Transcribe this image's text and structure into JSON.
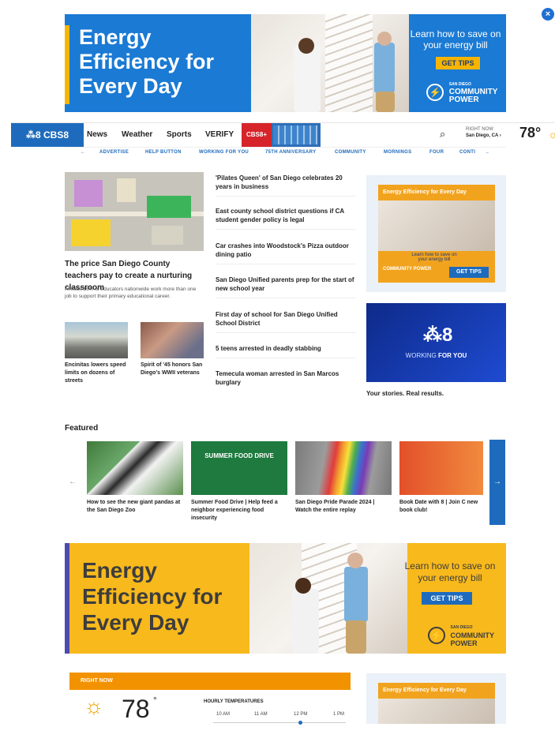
{
  "close": "×",
  "ad_top": {
    "headline": "Energy Efficiency for Every Day",
    "cta_text": "Learn how to save on your energy bill",
    "button": "GET TIPS",
    "logo_top": "SAN DIEGO",
    "logo_mid": "COMMUNITY",
    "logo_bot": "POWER"
  },
  "nav": {
    "brand": "⁂8 CBS8",
    "links": [
      "News",
      "Weather",
      "Sports",
      "VERIFY"
    ],
    "cbs_plus": "CBS8+",
    "search_icon": "⌕",
    "right_now_label": "RIGHT NOW",
    "location": "San Diego, CA ›",
    "temp": "78°",
    "weather_icon": "☼"
  },
  "subnav": [
    "←",
    "ADVERTISE",
    "HELP BUTTON",
    "WORKING FOR YOU",
    "75TH ANNIVERSARY",
    "COMMUNITY",
    "MORNINGS",
    "FOUR",
    "CONTI",
    "→"
  ],
  "lead": {
    "title": "The price San Diego County teachers pay to create a nurturing classroom",
    "subtitle": "At least 16% of educators nationwide work more than one job to support their primary educational career."
  },
  "small_cards": [
    {
      "title": "Encinitas lowers speed limits on dozens of streets"
    },
    {
      "title": "Spirit of '45 honors San Diego's WWII veterans"
    }
  ],
  "headlines": [
    "'Pilates Queen' of San Diego celebrates 20 years in business",
    "East county school district questions if CA student gender policy is legal",
    "Car crashes into Woodstock's Pizza outdoor dining patio",
    "San Diego Unified parents prep for the start of new school year",
    "First day of school for San Diego Unified School District",
    "5 teens arrested in deadly stabbing",
    "Temecula woman arrested in San Marcos burglary"
  ],
  "side_ad": {
    "title": "Energy Efficiency for Every Day",
    "caption": "Learn how to save on your energy bill",
    "button": "GET TIPS",
    "logo": "COMMUNITY POWER"
  },
  "wfy": {
    "logo": "⁂8",
    "text_pre": "WORKING",
    "text_bold": "FOR YOU",
    "caption": "Your stories. Real results."
  },
  "featured": {
    "heading": "Featured",
    "prev": "←",
    "next": "→",
    "cards": [
      {
        "title": "How to see the new giant pandas at the San Diego Zoo"
      },
      {
        "title": "Summer Food Drive | Help feed a neighbor experiencing food insecurity"
      },
      {
        "title": "San Diego Pride Parade 2024 | Watch the entire replay"
      },
      {
        "title": "Book Date with 8 | Join C new book club!"
      }
    ],
    "food_drive_label": "SUMMER FOOD DRIVE"
  },
  "ad_big": {
    "headline": "Energy Efficiency for Every Day",
    "cta_text": "Learn how to save on your energy bill",
    "button": "GET TIPS",
    "logo_top": "SAN DIEGO",
    "logo_mid": "COMMUNITY",
    "logo_bot": "POWER"
  },
  "right_now": {
    "label": "RIGHT NOW",
    "sun": "☼",
    "temp": "78",
    "deg": "°",
    "hourly_heading": "HOURLY TEMPERATURES",
    "hours": [
      "10 AM",
      "11 AM",
      "12 PM",
      "1 PM"
    ]
  },
  "side_ad2": {
    "title": "Energy Efficiency for Every Day"
  }
}
